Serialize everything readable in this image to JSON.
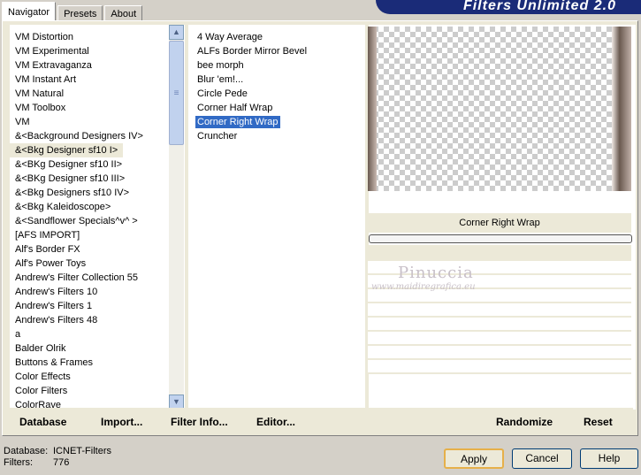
{
  "tabs": [
    "Navigator",
    "Presets",
    "About"
  ],
  "banner_title": "Filters Unlimited 2.0",
  "categories": [
    "VM Distortion",
    "VM Experimental",
    "VM Extravaganza",
    "VM Instant Art",
    "VM Natural",
    "VM Toolbox",
    "VM",
    "&<Background Designers IV>",
    "&<Bkg Designer sf10 I>",
    "&<BKg Designer sf10 II>",
    "&<BKg Designer sf10 III>",
    "&<Bkg Designers sf10 IV>",
    "&<Bkg Kaleidoscope>",
    "&<Sandflower Specials^v^ >",
    "[AFS IMPORT]",
    "Alf's Border FX",
    "Alf's Power Toys",
    "Andrew's Filter Collection 55",
    "Andrew's Filters 10",
    "Andrew's Filters 1",
    "Andrew's Filters 48",
    "a",
    "Balder Olrik",
    "Buttons & Frames",
    "Color Effects",
    "Color Filters",
    "ColorRave"
  ],
  "selected_category_index": 8,
  "filters": [
    "4 Way Average",
    "ALFs Border Mirror Bevel",
    "bee morph",
    "Blur 'em!...",
    "Circle Pede",
    "Corner Half Wrap",
    "Corner Right Wrap",
    "Cruncher"
  ],
  "selected_filter_index": 6,
  "filter_name_display": "Corner Right Wrap",
  "watermark": {
    "name": "Pinuccia",
    "url": "www.maidiregrafica.eu"
  },
  "toolbar": {
    "database": "Database",
    "import": "Import...",
    "filter_info": "Filter Info...",
    "editor": "Editor...",
    "randomize": "Randomize",
    "reset": "Reset"
  },
  "status": {
    "database_label": "Database:",
    "database_value": "ICNET-Filters",
    "filters_label": "Filters:",
    "filters_value": "776"
  },
  "dialog_buttons": {
    "apply": "Apply",
    "cancel": "Cancel",
    "help": "Help"
  },
  "icons": {
    "scroll_up": "chevron-up-icon",
    "scroll_down": "chevron-down-icon",
    "scroll_grip": "grip-icon"
  }
}
